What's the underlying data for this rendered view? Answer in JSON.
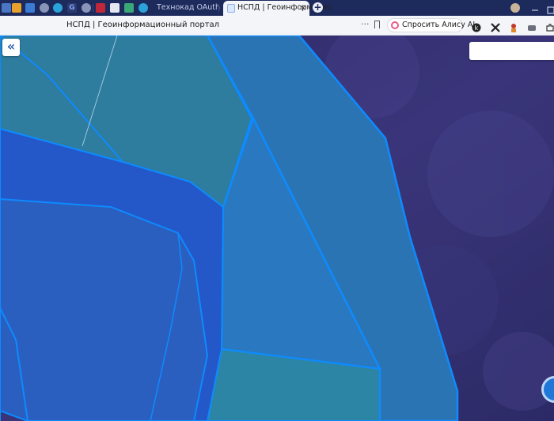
{
  "browser": {
    "tabs": [
      {
        "title": "Технокад OAuth",
        "active": false
      },
      {
        "title": "НСПД | Геоинформацио",
        "active": true
      }
    ],
    "close_glyph": "×",
    "new_tab_glyph": "+",
    "icons": [
      "vk-icon",
      "yandex-icon",
      "mail-icon",
      "globe-icon",
      "telegram-icon",
      "google-icon",
      "rosreestr-icon",
      "youtube-icon",
      "doc-icon",
      "doc-icon",
      "telegram-icon",
      "globe-icon",
      "telegram-icon"
    ],
    "colors": {
      "tabbar": "#1d2a5c",
      "toolbar": "#f4f5f8"
    }
  },
  "toolbar": {
    "page_title": "НСПД | Геоинформационный портал",
    "more_glyph": "···",
    "alice_label": "Спросить Алису AI"
  },
  "map": {
    "collapse_glyph": "«",
    "colors": {
      "imagery": "#2d2a6a",
      "parcel_fill": "#2a7fc9",
      "parcel_stroke": "#0d8bff",
      "road_band": "#2457c8"
    }
  }
}
